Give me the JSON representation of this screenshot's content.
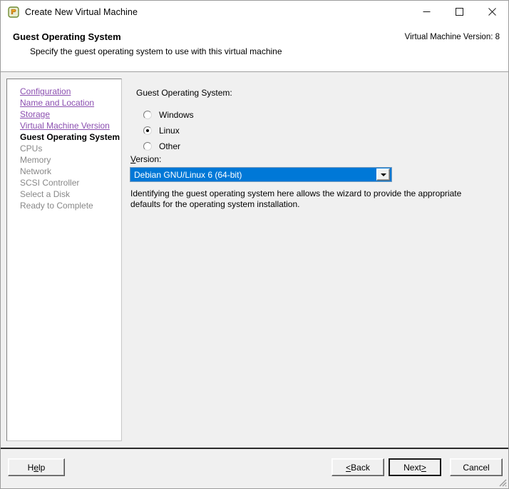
{
  "window": {
    "title": "Create New Virtual Machine",
    "icon": "vm-app-icon",
    "controls": {
      "minimize": "minimize-icon",
      "maximize": "maximize-icon",
      "close": "close-icon"
    }
  },
  "header": {
    "title": "Guest Operating System",
    "subtitle": "Specify the guest operating system to use with this virtual machine",
    "version_label": "Virtual Machine Version: 8"
  },
  "sidebar": {
    "items": [
      {
        "label": "Configuration",
        "state": "link"
      },
      {
        "label": "Name and Location",
        "state": "link"
      },
      {
        "label": "Storage",
        "state": "link"
      },
      {
        "label": "Virtual Machine Version",
        "state": "link"
      },
      {
        "label": "Guest Operating System",
        "state": "current"
      },
      {
        "label": "CPUs",
        "state": "pending"
      },
      {
        "label": "Memory",
        "state": "pending"
      },
      {
        "label": "Network",
        "state": "pending"
      },
      {
        "label": "SCSI Controller",
        "state": "pending"
      },
      {
        "label": "Select a Disk",
        "state": "pending"
      },
      {
        "label": "Ready to Complete",
        "state": "pending"
      }
    ]
  },
  "main": {
    "guest_os_label": "Guest Operating System:",
    "radios": [
      {
        "label": "Windows",
        "checked": false
      },
      {
        "label": "Linux",
        "checked": true
      },
      {
        "label": "Other",
        "checked": false
      }
    ],
    "version_label_prefix": "V",
    "version_label_rest": "ersion:",
    "version_selected": "Debian GNU/Linux 6 (64-bit)",
    "dropdown_icon": "chevron-down-icon",
    "description": "Identifying the guest operating system here allows the wizard to provide the appropriate defaults for the operating system installation."
  },
  "footer": {
    "help_prefix": "H",
    "help_accel": "e",
    "help_rest": "lp",
    "back_accel": "<",
    "back_rest": " Back",
    "next_prefix": "Next ",
    "next_accel": ">",
    "cancel_label": "Cancel",
    "resize_grip": "resize-grip-icon"
  },
  "colors": {
    "selection_blue": "#0078d7",
    "link_purple": "#8b4fb0",
    "window_bg": "#f0f0f0",
    "panel_white": "#ffffff"
  }
}
